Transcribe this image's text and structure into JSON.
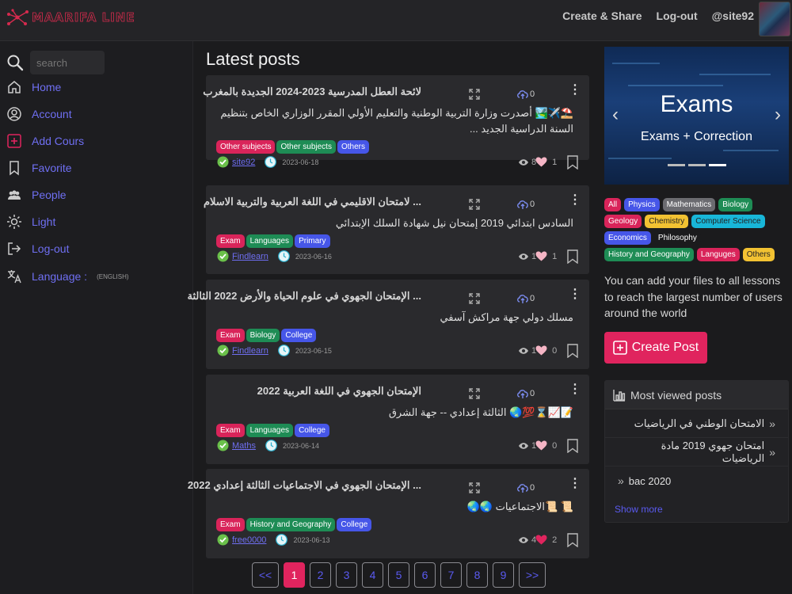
{
  "header": {
    "logo_text": "MAARIFA LINE",
    "nav": [
      {
        "label": "Create & Share"
      },
      {
        "label": "Log-out"
      },
      {
        "label": "@site92"
      }
    ]
  },
  "sidebar": {
    "search_placeholder": "search",
    "items": [
      {
        "label": "Home",
        "icon": "home-icon"
      },
      {
        "label": "Account",
        "icon": "user-circle-icon"
      },
      {
        "label": "Add Cours",
        "icon": "plus-square-icon"
      },
      {
        "label": "Favorite",
        "icon": "bookmark-icon"
      },
      {
        "label": "People",
        "icon": "people-icon"
      },
      {
        "label": "Light",
        "icon": "sun-icon"
      },
      {
        "label": "Log-out",
        "icon": "logout-icon"
      },
      {
        "label": "Language :",
        "suffix": "(ENGLISH)",
        "icon": "translate-icon"
      }
    ]
  },
  "main": {
    "title": "Latest posts",
    "posts": [
      {
        "title": "لائحة العطل المدرسية 2023-2024 الجديدة بالمغرب",
        "desc": "⛱️✈️🏞️ أصدرت وزارة التربية الوطنية والتعليم الأولي المقرر الوزاري الخاص بتنظيم السنة الدراسية الجديد ...",
        "uploads": "0",
        "tags": [
          {
            "label": "Other subjects",
            "color": "#d9245a"
          },
          {
            "label": "Other subjects",
            "color": "#1e8c55"
          },
          {
            "label": "Others",
            "color": "#4656e8"
          }
        ],
        "author": "site92",
        "date": "2023-06-18",
        "views": "8",
        "likes": "1",
        "liked": false
      },
      {
        "title": "... لامتحان الاقليمي في اللغة العربية والتربية الاسلام",
        "desc": "السادس ابتدائي 2019 إمتحان نيل شهادة السلك الإبتدائي",
        "uploads": "0",
        "tags": [
          {
            "label": "Exam",
            "color": "#d9245a"
          },
          {
            "label": "Languages",
            "color": "#1e8c55"
          },
          {
            "label": "Primary",
            "color": "#4656e8"
          }
        ],
        "author": "Findlearn",
        "date": "2023-06-16",
        "views": "1",
        "likes": "1",
        "liked": false
      },
      {
        "title": "... الإمتحان الجهوي في علوم الحياة والأرض 2022 الثالثة",
        "desc": "مسلك دولي جهة مراكش آسفي",
        "uploads": "0",
        "tags": [
          {
            "label": "Exam",
            "color": "#d9245a"
          },
          {
            "label": "Biology",
            "color": "#1e8c55"
          },
          {
            "label": "College",
            "color": "#4656e8"
          }
        ],
        "author": "Findlearn",
        "date": "2023-06-15",
        "views": "1",
        "likes": "0",
        "liked": false
      },
      {
        "title": "الإمتحان الجهوي في اللغة العربية 2022",
        "desc": "📝📈⌛️💯🌏 الثالثة إعدادي -- جهة الشرق",
        "uploads": "0",
        "tags": [
          {
            "label": "Exam",
            "color": "#d9245a"
          },
          {
            "label": "Languages",
            "color": "#1e8c55"
          },
          {
            "label": "College",
            "color": "#4656e8"
          }
        ],
        "author": "Maths",
        "date": "2023-06-14",
        "views": "1",
        "likes": "0",
        "liked": false
      },
      {
        "title": "... الإمتحان الجهوي في الاجتماعيات الثالثة إعدادي 2022",
        "desc": "📜 📜الاجتماعيات 🌏🌏",
        "uploads": "0",
        "tags": [
          {
            "label": "Exam",
            "color": "#d9245a"
          },
          {
            "label": "History and Geography",
            "color": "#1e8c55"
          },
          {
            "label": "College",
            "color": "#4656e8"
          }
        ],
        "author": "free0000",
        "date": "2023-06-13",
        "views": "4",
        "likes": "2",
        "liked": true
      }
    ],
    "pagination": {
      "prev": "<<",
      "pages": [
        "1",
        "2",
        "3",
        "4",
        "5",
        "6",
        "7",
        "8",
        "9"
      ],
      "current": "1",
      "next": ">>"
    }
  },
  "right": {
    "carousel": {
      "title": "Exams",
      "subtitle": "Exams + Correction",
      "prev": "‹",
      "next": "›"
    },
    "categories": [
      {
        "label": "All",
        "color": "#d9245a"
      },
      {
        "label": "Physics",
        "color": "#4656e8"
      },
      {
        "label": "Mathematics",
        "color": "#6b6b70"
      },
      {
        "label": "Biology",
        "color": "#1e8c55"
      },
      {
        "label": "Geology",
        "color": "#d9245a"
      },
      {
        "label": "Chemistry",
        "color": "#f2c232",
        "text": "#222"
      },
      {
        "label": "Computer Science",
        "color": "#18b6d8",
        "text": "#222"
      },
      {
        "label": "Economics",
        "color": "#4656e8"
      },
      {
        "label": "Philosophy",
        "color": "#1b1b1d"
      },
      {
        "label": "History and Geography",
        "color": "#1e8c55"
      },
      {
        "label": "Languges",
        "color": "#d9245a"
      },
      {
        "label": "Others",
        "color": "#f2c232",
        "text": "#222"
      }
    ],
    "info": "You can add your files to all lessons to reach the largest number of users around the world",
    "create_post": "Create Post",
    "most_viewed": {
      "title": "Most viewed posts",
      "items": [
        "الامتحان الوطني في الرياضيات",
        "امتحان جهوي 2019 مادة الرياضيات",
        "bac 2020"
      ],
      "show_more": "Show more"
    }
  }
}
